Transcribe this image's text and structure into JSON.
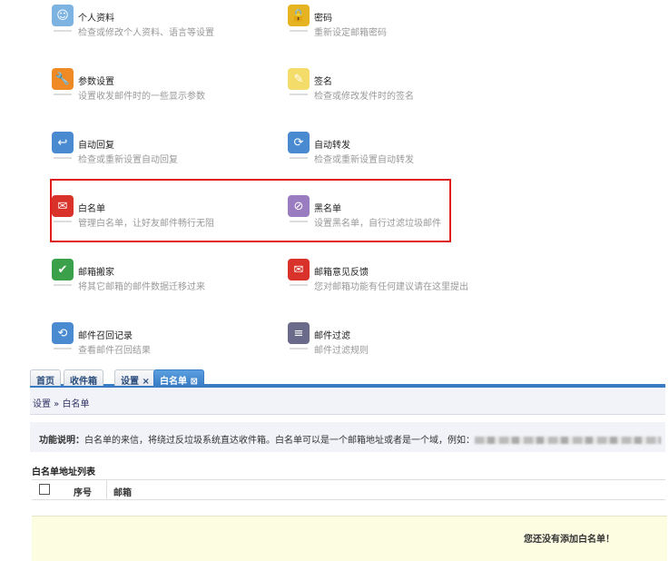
{
  "settings": [
    {
      "title": "个人资料",
      "desc": "检查或修改个人资料、语言等设置",
      "icon": "profile-icon",
      "color": "#7cb3e0"
    },
    {
      "title": "密码",
      "desc": "重新设定邮箱密码",
      "icon": "lock-icon",
      "color": "#e6b422"
    },
    {
      "title": "参数设置",
      "desc": "设置收发邮件时的一些显示参数",
      "icon": "wrench-icon",
      "color": "#f08a24"
    },
    {
      "title": "签名",
      "desc": "检查或修改发件时的签名",
      "icon": "signature-icon",
      "color": "#f3dc6a"
    },
    {
      "title": "自动回复",
      "desc": "检查或重新设置自动回复",
      "icon": "auto-reply-icon",
      "color": "#4a8ad0"
    },
    {
      "title": "自动转发",
      "desc": "检查或重新设置自动转发",
      "icon": "auto-forward-icon",
      "color": "#4a8ad0"
    },
    {
      "title": "白名单",
      "desc": "管理白名单，让好友邮件畅行无阻",
      "icon": "whitelist-icon",
      "color": "#d8322a"
    },
    {
      "title": "黑名单",
      "desc": "设置黑名单，自行过滤垃圾邮件",
      "icon": "blacklist-icon",
      "color": "#9a7cc0"
    },
    {
      "title": "邮箱搬家",
      "desc": "将其它邮箱的邮件数据迁移过来",
      "icon": "mailbox-move-icon",
      "color": "#3aa04a"
    },
    {
      "title": "邮箱意见反馈",
      "desc": "您对邮箱功能有任何建议请在这里提出",
      "icon": "feedback-icon",
      "color": "#d8322a"
    },
    {
      "title": "邮件召回记录",
      "desc": "查看邮件召回结果",
      "icon": "recall-icon",
      "color": "#4a8ad0"
    },
    {
      "title": "邮件过滤",
      "desc": "邮件过滤规则",
      "icon": "filter-icon",
      "color": "#6a6a8a"
    }
  ],
  "tabs": [
    {
      "label": "首页"
    },
    {
      "label": "收件箱"
    },
    {
      "label": "设置",
      "close": "×"
    },
    {
      "label": "白名单",
      "close": "⊠"
    }
  ],
  "breadcrumb": {
    "parent": "设置",
    "sep": " » ",
    "current": "白名单"
  },
  "info": {
    "label": "功能说明：",
    "text": "白名单的来信，将绕过反垃圾系统直达收件箱。白名单可以是一个邮箱地址或者是一个域，例如："
  },
  "list": {
    "heading": "白名单地址列表",
    "col_index": "序号",
    "col_email": "邮箱",
    "empty": "您还没有添加白名单！"
  }
}
